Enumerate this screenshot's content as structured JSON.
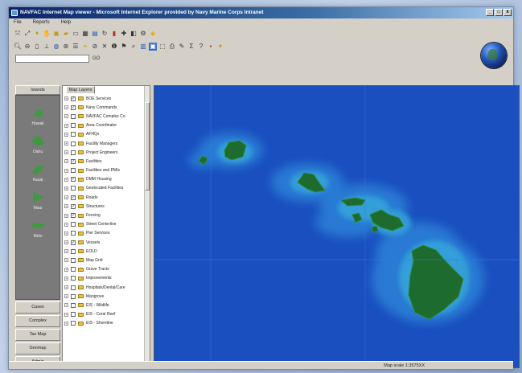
{
  "window": {
    "title": "NAVFAC Internet Map viewer - Microsoft Internet Explorer provided by Navy Marine Corps Intranet",
    "controls": [
      "_",
      "□",
      "x"
    ]
  },
  "menu": [
    "File",
    "Reports",
    "Help"
  ],
  "toolbar_row1_icons": [
    "zoom-full-icon",
    "zoom-extent-icon",
    "pan-icon",
    "hand-icon",
    "print-icon",
    "folder-icon",
    "document-icon",
    "grid-icon",
    "layers-icon",
    "refresh-icon",
    "chart-icon",
    "add-layer-icon",
    "query-icon",
    "gear-icon",
    "highlight-icon"
  ],
  "toolbar_row2_icons": [
    "zoom-in-icon",
    "zoom-out-icon",
    "select-icon",
    "measure-icon",
    "globe-small-icon",
    "identify-icon",
    "legend-icon",
    "locate-icon",
    "clear-icon",
    "info-icon",
    "buffer-icon",
    "link-icon",
    "search-icon",
    "map-icon",
    "edit-icon",
    "tag-icon",
    "print2-icon",
    "draw-icon",
    "text-icon",
    "help-icon",
    "export-icon",
    "layout-icon"
  ],
  "address": {
    "value": "",
    "go": "GO"
  },
  "left_panel": {
    "tab": "Islands",
    "items": [
      {
        "label": "Hawaii"
      },
      {
        "label": "Oahu"
      },
      {
        "label": "Kauai"
      },
      {
        "label": "Maui"
      },
      {
        "label": "Molo"
      }
    ],
    "buttons": [
      "Cases",
      "Complex",
      "Tax Map",
      "Geomap",
      "Admin"
    ]
  },
  "layers": {
    "tab": "Map Layers",
    "items": [
      {
        "label": "BOE Services",
        "checked": true
      },
      {
        "label": "Navy Commands",
        "checked": true
      },
      {
        "label": "NAVFAC Complex Co",
        "checked": false
      },
      {
        "label": "Area Coordinator",
        "checked": false
      },
      {
        "label": "AFHQs",
        "checked": false
      },
      {
        "label": "Facility Managers",
        "checked": false
      },
      {
        "label": "Project Engineers",
        "checked": false
      },
      {
        "label": "Facilities",
        "checked": true
      },
      {
        "label": "Facilities and PMIs",
        "checked": false
      },
      {
        "label": "DMM Housing",
        "checked": true
      },
      {
        "label": "Geolocated Facilities",
        "checked": false
      },
      {
        "label": "Roads",
        "checked": true
      },
      {
        "label": "Structures",
        "checked": true
      },
      {
        "label": "Fencing",
        "checked": true
      },
      {
        "label": "Street Centerline",
        "checked": false
      },
      {
        "label": "Pier Services",
        "checked": false
      },
      {
        "label": "Vessels",
        "checked": true
      },
      {
        "label": "EOLD",
        "checked": false
      },
      {
        "label": "Map Grid",
        "checked": false
      },
      {
        "label": "Grave Tracts",
        "checked": false
      },
      {
        "label": "Improvements",
        "checked": false
      },
      {
        "label": "Hospitals/Dental/Care",
        "checked": false
      },
      {
        "label": "Mangrove",
        "checked": false
      },
      {
        "label": "EIS - Wildlife",
        "checked": false
      },
      {
        "label": "EIS - Coral Reef",
        "checked": false
      },
      {
        "label": "EIS - Shoreline",
        "checked": false
      }
    ]
  },
  "map": {
    "colors": {
      "ocean": "#1a4fbf",
      "shelf": "#2d8ad8",
      "land": "#1d6b2e"
    }
  },
  "status": {
    "scale": "Map scale 1:3575XX"
  }
}
